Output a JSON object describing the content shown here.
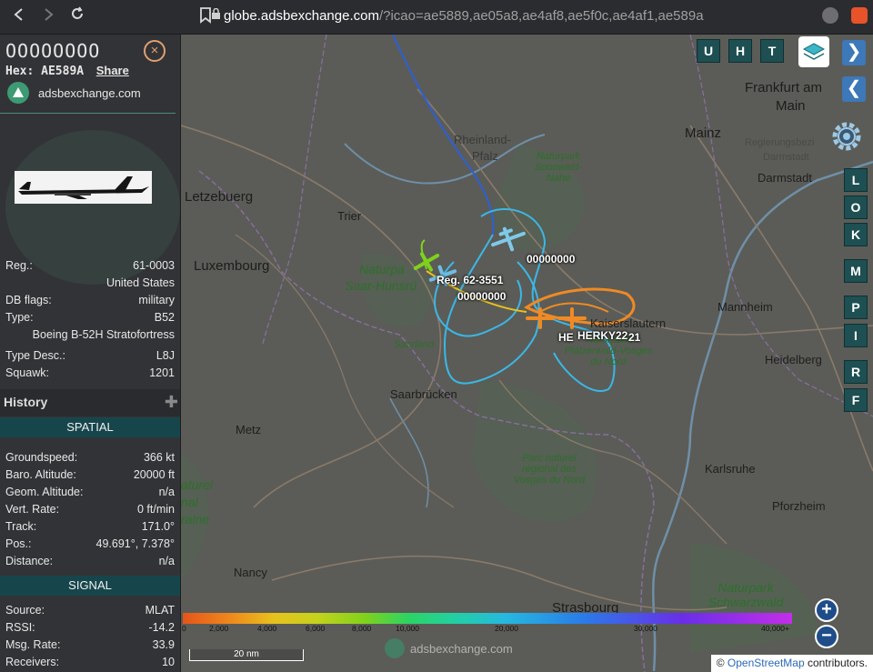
{
  "browser": {
    "url_host": "globe.adsbexchange.com",
    "url_path": "/?icao=ae5889,ae05a8,ae4af8,ae5f0c,ae4af1,ae589a"
  },
  "sidebar": {
    "callsign": "OOOOOOOO",
    "hex_label": "Hex: AE589A",
    "share_label": "Share",
    "site_label": "adsbexchange.com",
    "info": {
      "reg_label": "Reg.:",
      "reg_value": "61-0003",
      "country": "United States",
      "dbflags_label": "DB flags:",
      "dbflags_value": "military",
      "type_label": "Type:",
      "type_value": "B52",
      "type_full": "Boeing B-52H Stratofortress",
      "typedesc_label": "Type Desc.:",
      "typedesc_value": "L8J",
      "squawk_label": "Squawk:",
      "squawk_value": "1201"
    },
    "history_title": "History",
    "spatial_title": "SPATIAL",
    "spatial": [
      {
        "label": "Groundspeed:",
        "value": "366 kt"
      },
      {
        "label": "Baro. Altitude:",
        "value": "20000 ft"
      },
      {
        "label": "Geom. Altitude:",
        "value": "n/a"
      },
      {
        "label": "Vert. Rate:",
        "value": "0 ft/min"
      },
      {
        "label": "Track:",
        "value": "171.0°"
      },
      {
        "label": "Pos.:",
        "value": "49.691°, 7.378°"
      },
      {
        "label": "Distance:",
        "value": "n/a"
      }
    ],
    "signal_title": "SIGNAL",
    "signal": [
      {
        "label": "Source:",
        "value": "MLAT"
      },
      {
        "label": "RSSI:",
        "value": "-14.2"
      },
      {
        "label": "Msg. Rate:",
        "value": "33.9"
      },
      {
        "label": "Receivers:",
        "value": "10"
      }
    ]
  },
  "map": {
    "places": {
      "frankfurt": "Frankfurt am",
      "main": "Main",
      "mainz": "Mainz",
      "darmstadt": "Darmstadt",
      "regbez": "Regierungsbezi",
      "darmstadt_reg": "Darmstadt",
      "letzebuerg": "Letzebuerg",
      "luxembourg": "Luxembourg",
      "trier": "Trier",
      "rheinland": "Rheinland-",
      "pfalz": "Pfalz",
      "soonwald": "Naturpark Soonwald-Nahe",
      "saarhunsrueck1": "Naturpa",
      "saarhunsrueck2": "Saar-Hunsrü",
      "saarland": "Saarland",
      "saarbrucken": "Saarbrücken",
      "kaiserslautern": "Kaiserslautern",
      "pfaelzerwald": "Naturpark Pfälzerwald-Vosges du Nord",
      "mannheim": "Mannheim",
      "heidelberg": "Heidelberg",
      "metz": "Metz",
      "vosges_park": "Parc naturel régional des Vosges du Nord",
      "lorraine1": "aturel",
      "lorraine2": "nal",
      "lorraine3": "raine",
      "karlsruhe": "Karlsruhe",
      "pforzheim": "Pforzheim",
      "nancy": "Nancy",
      "strasbourg": "Strasbourg",
      "schwarzwald": "Naturpark Schwarzwald"
    },
    "aircraft_labels": {
      "a1": "00000000",
      "a2": "Reg. 62-3551",
      "a3": "00000000",
      "a4": "HERKY22",
      "a5": "HE",
      "a6": "21"
    },
    "buttons": {
      "u": "U",
      "h": "H",
      "t": "T",
      "l": "L",
      "o": "O",
      "k": "K",
      "m": "M",
      "p": "P",
      "i": "I",
      "r": "R",
      "f": "F",
      "next": "❯",
      "prev": "❮",
      "zoom_in": "+",
      "zoom_out": "−"
    },
    "legend": {
      "ticks": [
        "0",
        "2,000",
        "4,000",
        "6,000",
        "8,000",
        "10,000",
        "20,000",
        "30,000",
        "40,000+"
      ]
    },
    "scale_label": "20 nm",
    "brand": "adsbexchange.com",
    "attribution_prefix": "© ",
    "attribution_link": "OpenStreetMap",
    "attribution_suffix": " contributors."
  },
  "colors": {
    "sidebar_bg": "#323336",
    "section_head": "#16464c",
    "map_button": "#1e4f52",
    "track_cyan": "#3bb7e6",
    "track_orange": "#f08a24",
    "track_blue": "#2d5fd6"
  }
}
